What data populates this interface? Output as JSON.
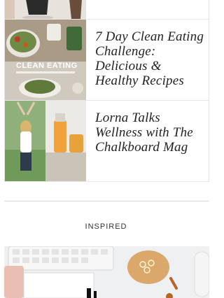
{
  "articles": [
    {
      "title": "7 Day Clean Eating Challenge: Delicious & Healthy Recipes",
      "image_text": "CLEAN EATING"
    },
    {
      "title": "Lorna Talks Wellness with The Chalkboard Mag"
    }
  ],
  "section": {
    "label": "INSPIRED"
  }
}
